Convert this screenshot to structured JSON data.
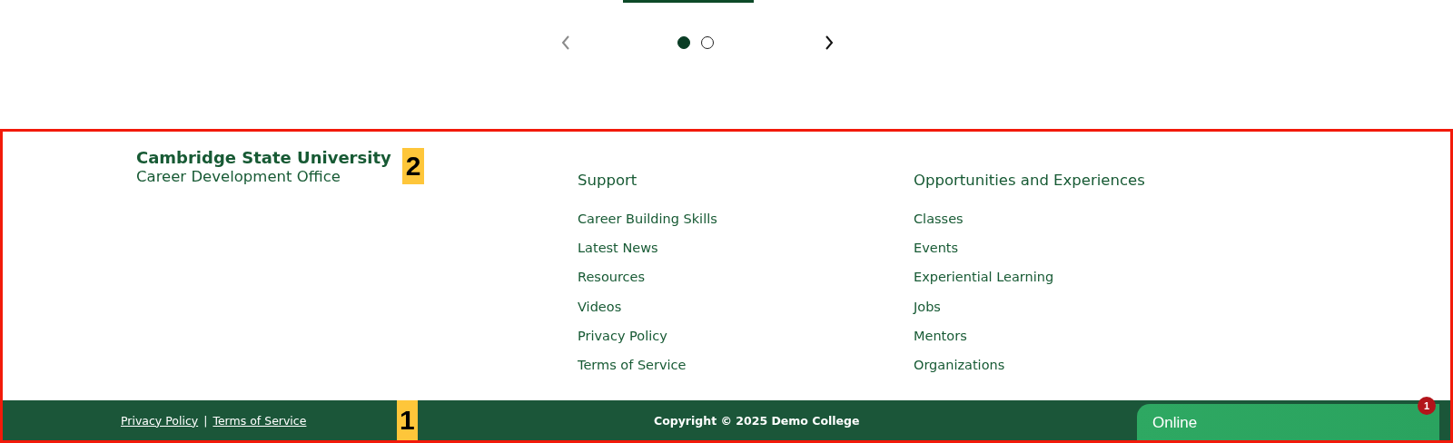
{
  "carousel": {
    "prev": {
      "disabled": true
    },
    "next": {
      "disabled": false
    },
    "dots": [
      {
        "selected": true
      },
      {
        "selected": false
      }
    ]
  },
  "footer": {
    "brand": {
      "title": "Cambridge State University",
      "subtitle": "Career Development Office",
      "marker": "2"
    },
    "columns": [
      {
        "heading": "Support",
        "links": [
          "Career Building Skills",
          "Latest News",
          "Resources",
          "Videos",
          "Privacy Policy",
          "Terms of Service"
        ]
      },
      {
        "heading": "Opportunities and Experiences",
        "links": [
          "Classes",
          "Events",
          "Experiential Learning",
          "Jobs",
          "Mentors",
          "Organizations"
        ]
      }
    ],
    "bottom_bar": {
      "links": [
        "Privacy Policy",
        "Terms of Service"
      ],
      "separator": "|",
      "marker": "1",
      "copyright": "Copyright © 2025 Demo College"
    }
  },
  "chat": {
    "label": "Online",
    "badge": "1"
  }
}
